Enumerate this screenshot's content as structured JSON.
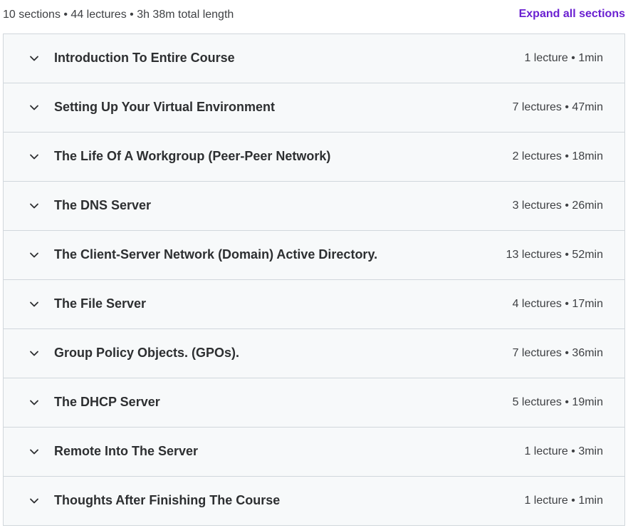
{
  "summary": {
    "text": "10 sections • 44 lectures • 3h 38m total length",
    "expand_all_label": "Expand all sections"
  },
  "icons": {
    "chevron": "chevron-down-icon"
  },
  "colors": {
    "accent": "#6a1fd1",
    "row_background": "#f7f9fa",
    "border": "#d1d7dc"
  },
  "sections": [
    {
      "title": "Introduction To Entire Course",
      "meta": "1 lecture • 1min"
    },
    {
      "title": "Setting Up Your Virtual Environment",
      "meta": "7 lectures • 47min"
    },
    {
      "title": "The Life Of A Workgroup (Peer-Peer Network)",
      "meta": "2 lectures • 18min"
    },
    {
      "title": "The DNS Server",
      "meta": "3 lectures • 26min"
    },
    {
      "title": "The Client-Server Network (Domain) Active Directory.",
      "meta": "13 lectures • 52min"
    },
    {
      "title": "The File Server",
      "meta": "4 lectures • 17min"
    },
    {
      "title": "Group Policy Objects. (GPOs).",
      "meta": "7 lectures • 36min"
    },
    {
      "title": "The DHCP Server",
      "meta": "5 lectures • 19min"
    },
    {
      "title": "Remote Into The Server",
      "meta": "1 lecture • 3min"
    },
    {
      "title": "Thoughts After Finishing The Course",
      "meta": "1 lecture • 1min"
    }
  ]
}
